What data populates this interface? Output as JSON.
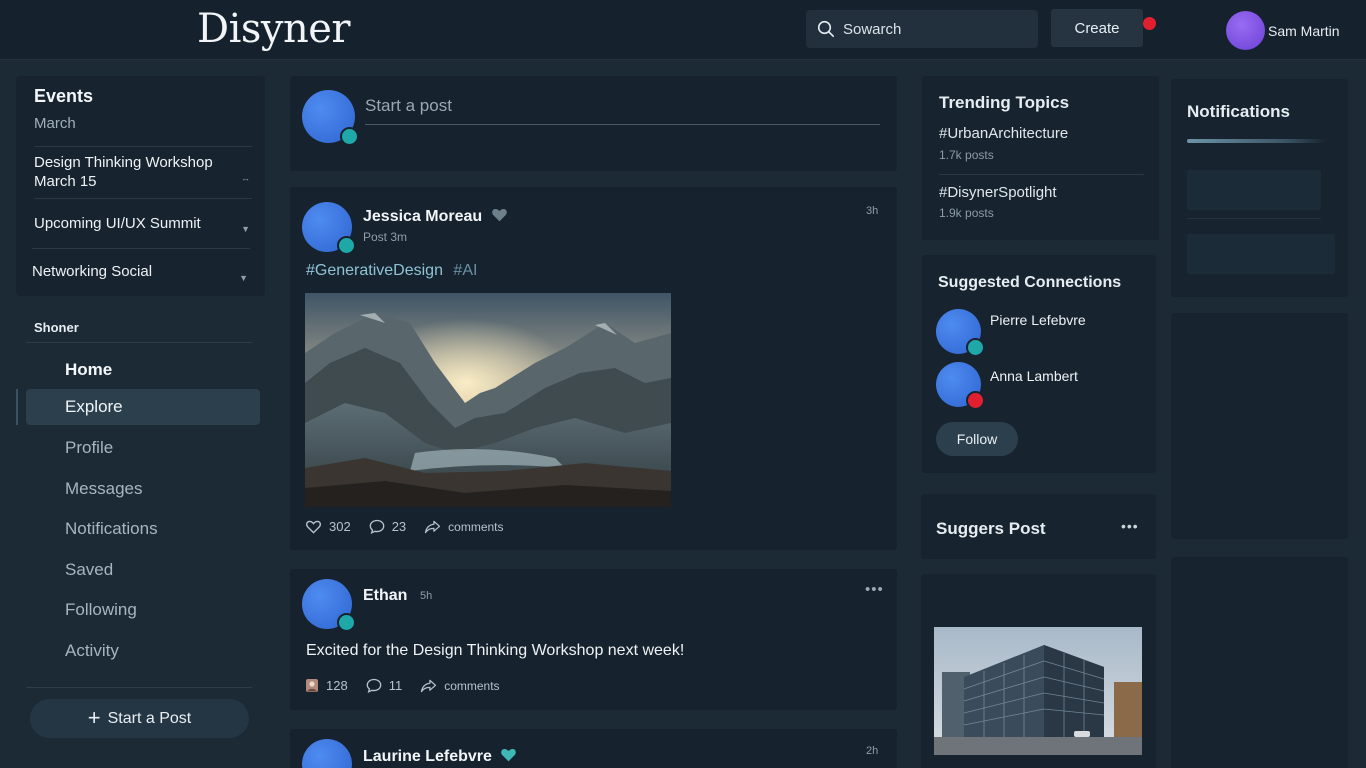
{
  "app": {
    "logo": "Disyner"
  },
  "header": {
    "search_placeholder": "Sowarch",
    "create_label": "Create",
    "user_name": "Sam Martin"
  },
  "events": {
    "title": "Events",
    "month": "March",
    "items": [
      {
        "line1": "Design Thinking Workshop",
        "line2": "March 15"
      },
      {
        "line1": "Upcoming UI/UX Summit",
        "line2": ""
      },
      {
        "line1": "Networking Social",
        "line2": ""
      }
    ]
  },
  "sidebar": {
    "section_label": "Shoner",
    "items": [
      "Home",
      "Explore",
      "Profile",
      "Messages",
      "Notifications",
      "Saved",
      "Following",
      "Activity"
    ],
    "active": "Explore",
    "start_post_label": "Start a Post"
  },
  "composer": {
    "placeholder": "Start a post"
  },
  "posts": [
    {
      "author": "Jessica Moreau",
      "sub": "Post 3m",
      "time": "3h",
      "tags": [
        "#GenerativeDesign",
        "#AI"
      ],
      "likes": "302",
      "comments": "23",
      "share_label": "comments"
    },
    {
      "author": "Ethan",
      "time": "5h",
      "text": "Excited for the Design Thinking Workshop next week!",
      "likes": "128",
      "comments": "11",
      "share_label": "comments"
    },
    {
      "author": "Laurine Lefebvre",
      "time": "2h"
    }
  ],
  "trending": {
    "title": "Trending Topics",
    "items": [
      {
        "tag": "#UrbanArchitecture",
        "count": "1.7k posts"
      },
      {
        "tag": "#DisynerSpotlight",
        "count": "1.9k posts"
      }
    ]
  },
  "connections": {
    "title": "Suggested Connections",
    "people": [
      "Pierre Lefebvre",
      "Anna Lambert"
    ],
    "follow_label": "Follow"
  },
  "suggested_post": {
    "title": "Suggers Post"
  },
  "notifications": {
    "title": "Notifications"
  },
  "colors": {
    "accent_teal": "#1fa8a8",
    "alert_red": "#e02030",
    "user_purple": "#8a5cf0",
    "avatar_blue": "#3f78e6"
  }
}
